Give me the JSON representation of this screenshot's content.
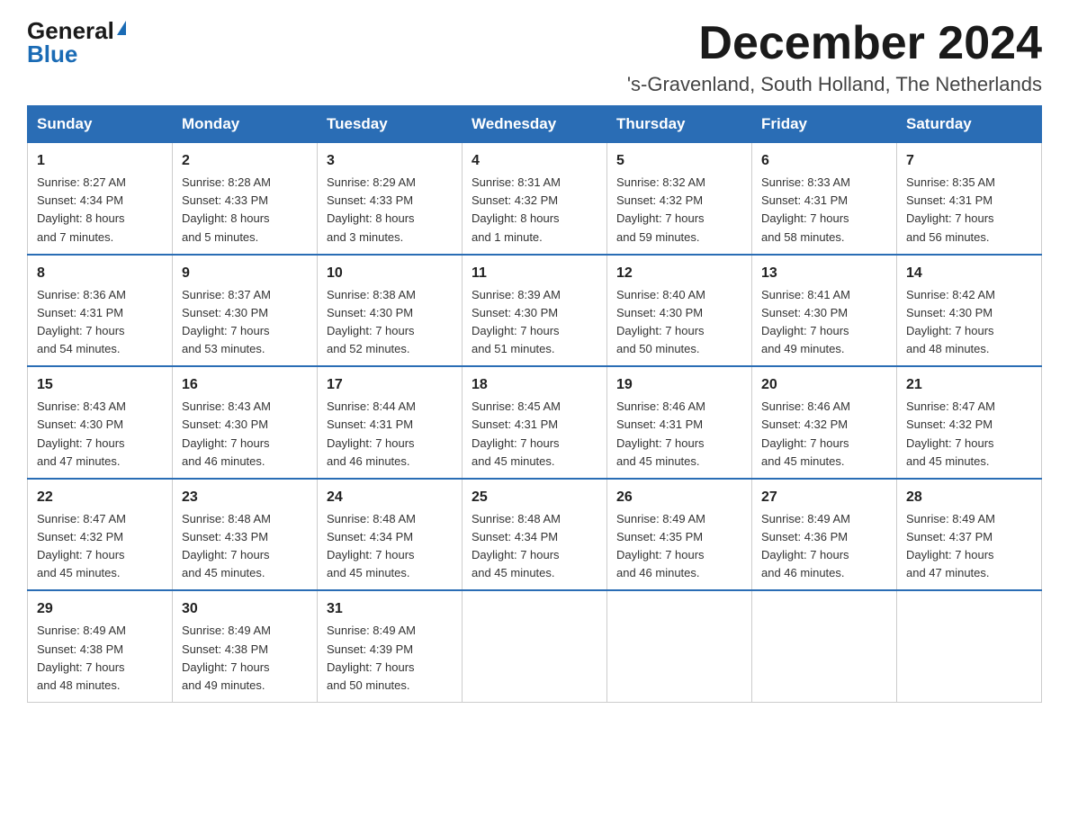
{
  "logo": {
    "general": "General",
    "arrow": "▶",
    "blue": "Blue"
  },
  "title": "December 2024",
  "location": "'s-Gravenland, South Holland, The Netherlands",
  "days_of_week": [
    "Sunday",
    "Monday",
    "Tuesday",
    "Wednesday",
    "Thursday",
    "Friday",
    "Saturday"
  ],
  "weeks": [
    [
      {
        "day": "1",
        "sunrise": "8:27 AM",
        "sunset": "4:34 PM",
        "daylight": "8 hours and 7 minutes."
      },
      {
        "day": "2",
        "sunrise": "8:28 AM",
        "sunset": "4:33 PM",
        "daylight": "8 hours and 5 minutes."
      },
      {
        "day": "3",
        "sunrise": "8:29 AM",
        "sunset": "4:33 PM",
        "daylight": "8 hours and 3 minutes."
      },
      {
        "day": "4",
        "sunrise": "8:31 AM",
        "sunset": "4:32 PM",
        "daylight": "8 hours and 1 minute."
      },
      {
        "day": "5",
        "sunrise": "8:32 AM",
        "sunset": "4:32 PM",
        "daylight": "7 hours and 59 minutes."
      },
      {
        "day": "6",
        "sunrise": "8:33 AM",
        "sunset": "4:31 PM",
        "daylight": "7 hours and 58 minutes."
      },
      {
        "day": "7",
        "sunrise": "8:35 AM",
        "sunset": "4:31 PM",
        "daylight": "7 hours and 56 minutes."
      }
    ],
    [
      {
        "day": "8",
        "sunrise": "8:36 AM",
        "sunset": "4:31 PM",
        "daylight": "7 hours and 54 minutes."
      },
      {
        "day": "9",
        "sunrise": "8:37 AM",
        "sunset": "4:30 PM",
        "daylight": "7 hours and 53 minutes."
      },
      {
        "day": "10",
        "sunrise": "8:38 AM",
        "sunset": "4:30 PM",
        "daylight": "7 hours and 52 minutes."
      },
      {
        "day": "11",
        "sunrise": "8:39 AM",
        "sunset": "4:30 PM",
        "daylight": "7 hours and 51 minutes."
      },
      {
        "day": "12",
        "sunrise": "8:40 AM",
        "sunset": "4:30 PM",
        "daylight": "7 hours and 50 minutes."
      },
      {
        "day": "13",
        "sunrise": "8:41 AM",
        "sunset": "4:30 PM",
        "daylight": "7 hours and 49 minutes."
      },
      {
        "day": "14",
        "sunrise": "8:42 AM",
        "sunset": "4:30 PM",
        "daylight": "7 hours and 48 minutes."
      }
    ],
    [
      {
        "day": "15",
        "sunrise": "8:43 AM",
        "sunset": "4:30 PM",
        "daylight": "7 hours and 47 minutes."
      },
      {
        "day": "16",
        "sunrise": "8:43 AM",
        "sunset": "4:30 PM",
        "daylight": "7 hours and 46 minutes."
      },
      {
        "day": "17",
        "sunrise": "8:44 AM",
        "sunset": "4:31 PM",
        "daylight": "7 hours and 46 minutes."
      },
      {
        "day": "18",
        "sunrise": "8:45 AM",
        "sunset": "4:31 PM",
        "daylight": "7 hours and 45 minutes."
      },
      {
        "day": "19",
        "sunrise": "8:46 AM",
        "sunset": "4:31 PM",
        "daylight": "7 hours and 45 minutes."
      },
      {
        "day": "20",
        "sunrise": "8:46 AM",
        "sunset": "4:32 PM",
        "daylight": "7 hours and 45 minutes."
      },
      {
        "day": "21",
        "sunrise": "8:47 AM",
        "sunset": "4:32 PM",
        "daylight": "7 hours and 45 minutes."
      }
    ],
    [
      {
        "day": "22",
        "sunrise": "8:47 AM",
        "sunset": "4:32 PM",
        "daylight": "7 hours and 45 minutes."
      },
      {
        "day": "23",
        "sunrise": "8:48 AM",
        "sunset": "4:33 PM",
        "daylight": "7 hours and 45 minutes."
      },
      {
        "day": "24",
        "sunrise": "8:48 AM",
        "sunset": "4:34 PM",
        "daylight": "7 hours and 45 minutes."
      },
      {
        "day": "25",
        "sunrise": "8:48 AM",
        "sunset": "4:34 PM",
        "daylight": "7 hours and 45 minutes."
      },
      {
        "day": "26",
        "sunrise": "8:49 AM",
        "sunset": "4:35 PM",
        "daylight": "7 hours and 46 minutes."
      },
      {
        "day": "27",
        "sunrise": "8:49 AM",
        "sunset": "4:36 PM",
        "daylight": "7 hours and 46 minutes."
      },
      {
        "day": "28",
        "sunrise": "8:49 AM",
        "sunset": "4:37 PM",
        "daylight": "7 hours and 47 minutes."
      }
    ],
    [
      {
        "day": "29",
        "sunrise": "8:49 AM",
        "sunset": "4:38 PM",
        "daylight": "7 hours and 48 minutes."
      },
      {
        "day": "30",
        "sunrise": "8:49 AM",
        "sunset": "4:38 PM",
        "daylight": "7 hours and 49 minutes."
      },
      {
        "day": "31",
        "sunrise": "8:49 AM",
        "sunset": "4:39 PM",
        "daylight": "7 hours and 50 minutes."
      },
      null,
      null,
      null,
      null
    ]
  ],
  "labels": {
    "sunrise": "Sunrise:",
    "sunset": "Sunset:",
    "daylight": "Daylight:"
  }
}
